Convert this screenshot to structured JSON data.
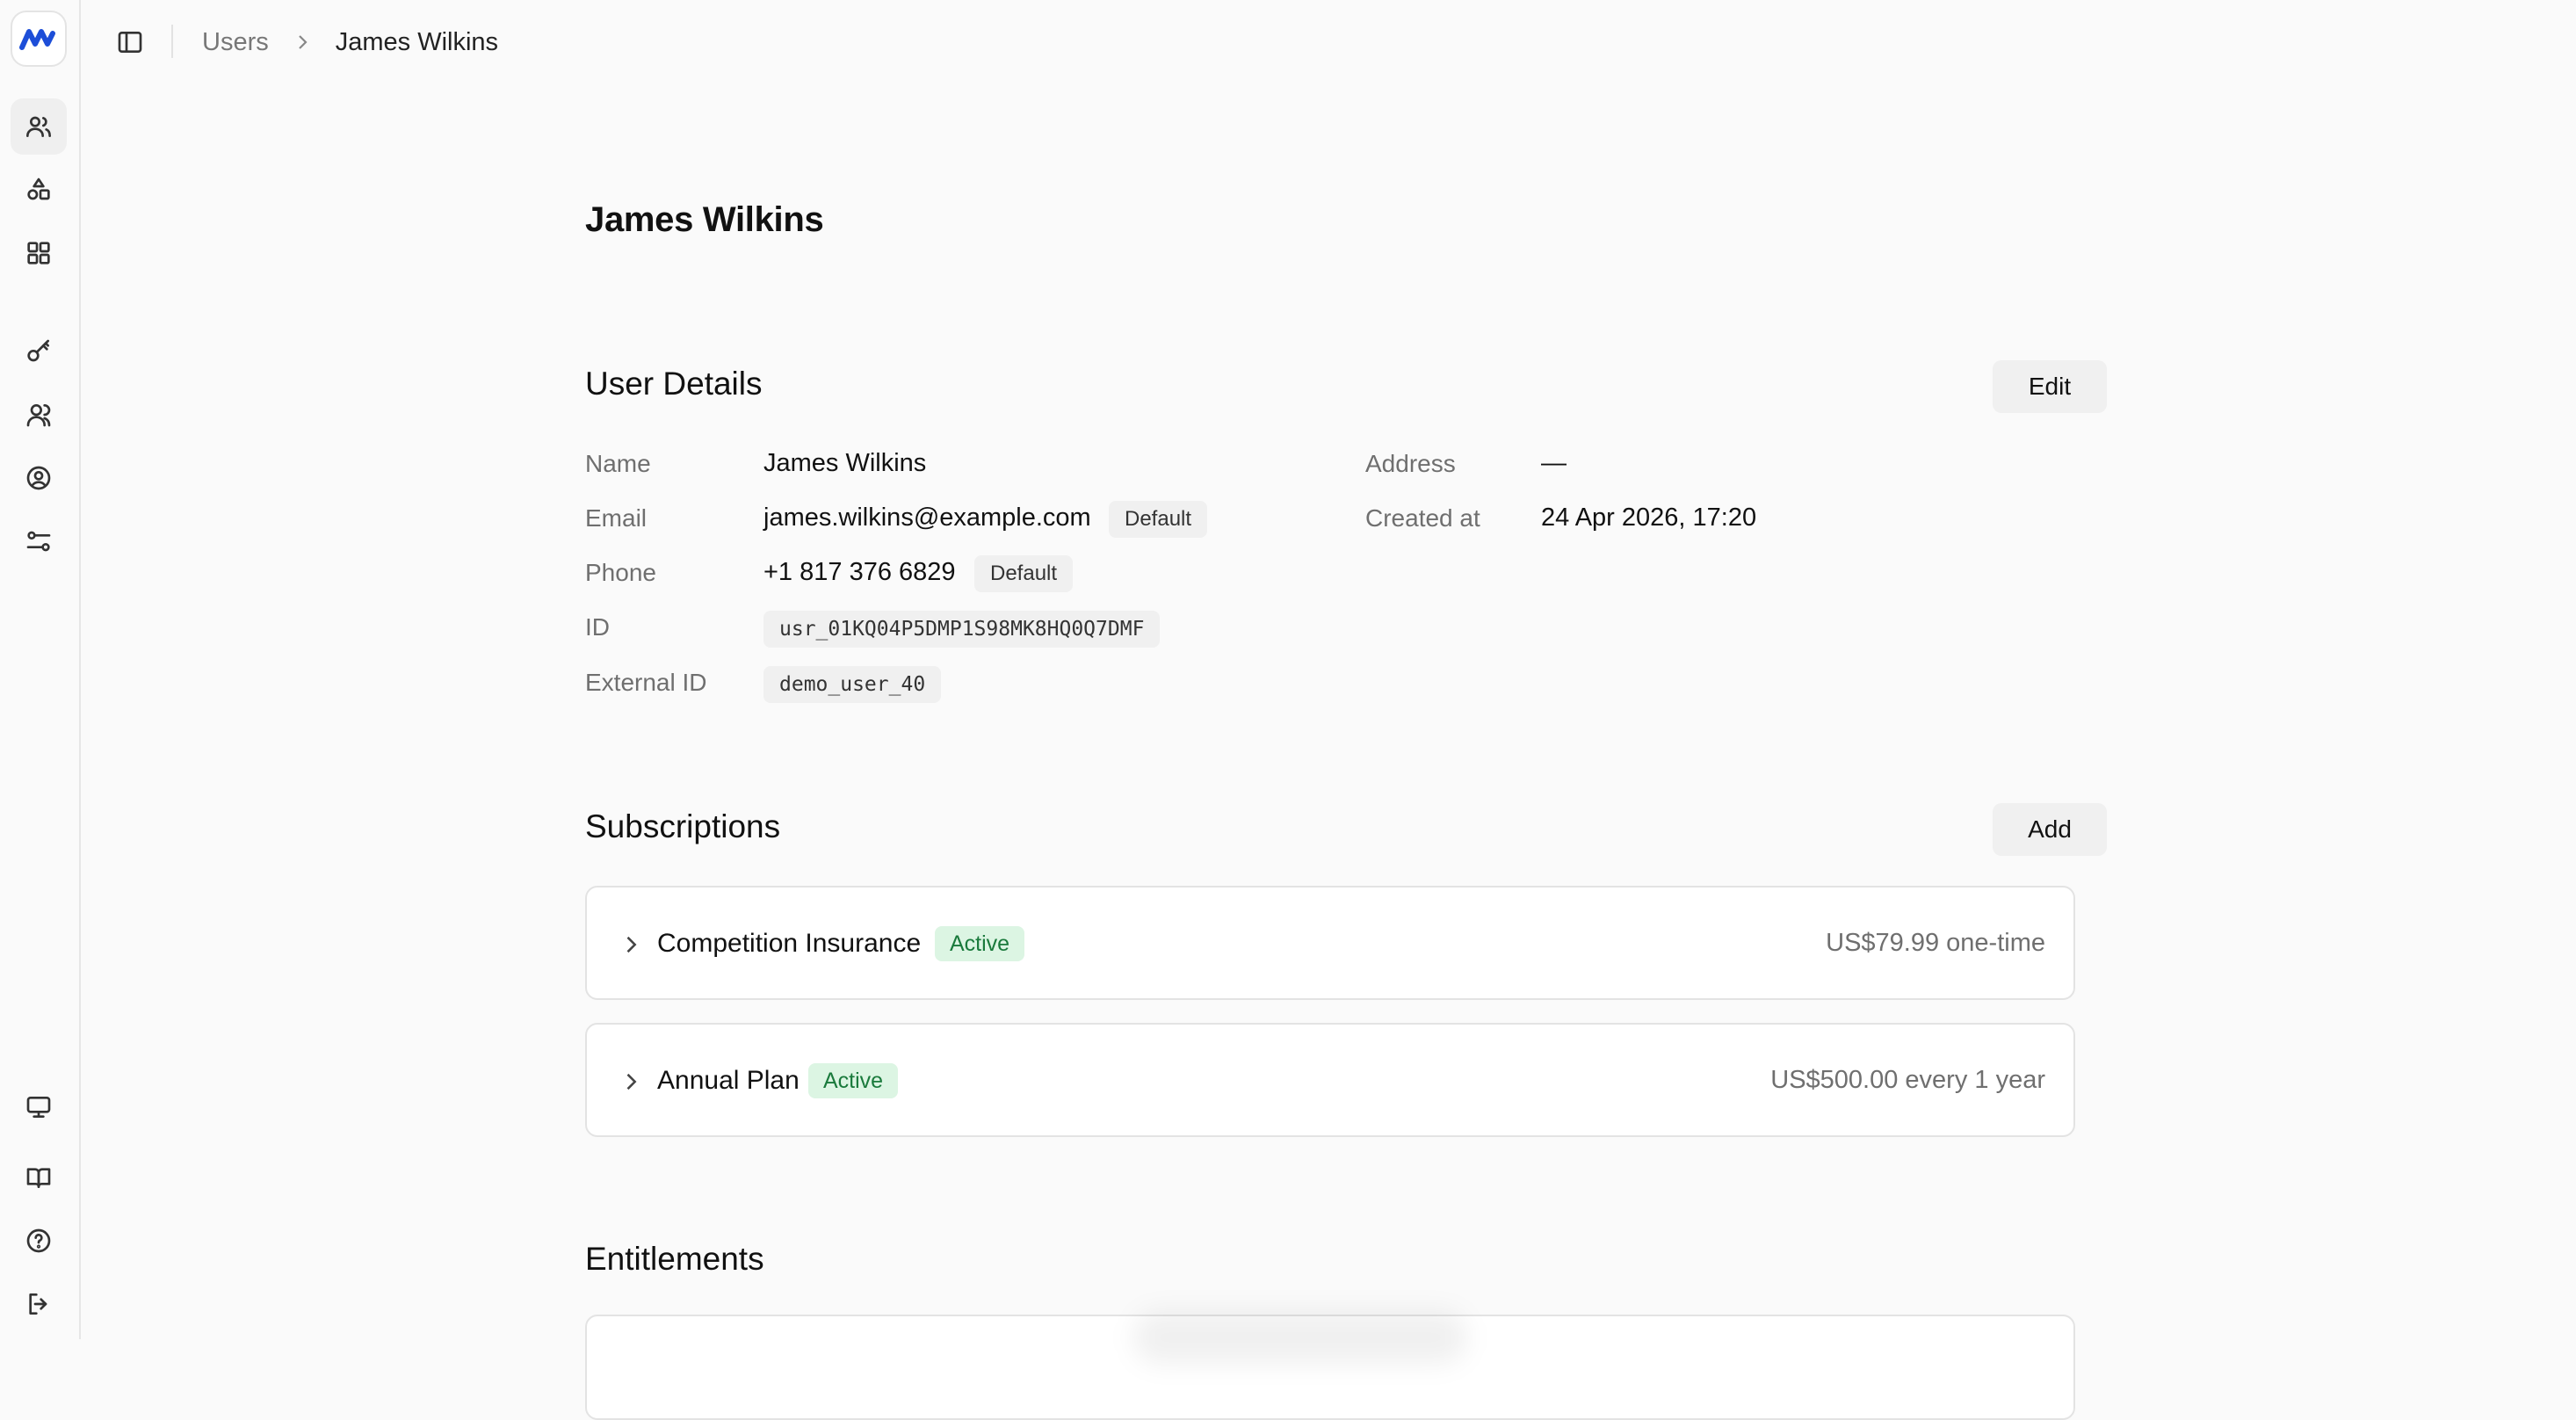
{
  "breadcrumb": {
    "parent": "Users",
    "current": "James Wilkins"
  },
  "page": {
    "title": "James Wilkins"
  },
  "user_details": {
    "title": "User Details",
    "edit_label": "Edit",
    "name_label": "Name",
    "name": "James Wilkins",
    "email_label": "Email",
    "email": "james.wilkins@example.com",
    "email_badge": "Default",
    "phone_label": "Phone",
    "phone": "+1 817 376 6829",
    "phone_badge": "Default",
    "id_label": "ID",
    "id": "usr_01KQ04P5DMP1S98MK8HQ0Q7DMF",
    "external_id_label": "External ID",
    "external_id": "demo_user_40",
    "address_label": "Address",
    "address": "—",
    "created_label": "Created at",
    "created": "24 Apr 2026, 17:20"
  },
  "subscriptions": {
    "title": "Subscriptions",
    "add_label": "Add",
    "items": [
      {
        "name": "Competition Insurance",
        "status": "Active",
        "price": "US$79.99 one-time"
      },
      {
        "name": "Annual Plan",
        "status": "Active",
        "price": "US$500.00 every 1 year"
      }
    ]
  },
  "entitlements": {
    "title": "Entitlements"
  },
  "sidebar": {
    "icons": [
      "users-icon",
      "shapes-icon",
      "grid-icon",
      "key-icon",
      "team-icon",
      "user-circle-icon",
      "settings-sliders-icon",
      "monitor-icon",
      "book-icon",
      "help-icon",
      "logout-icon"
    ]
  },
  "colors": {
    "accent": "#1d4ed8",
    "status_bg": "#dcf5e3",
    "status_text": "#1a7a3c"
  }
}
